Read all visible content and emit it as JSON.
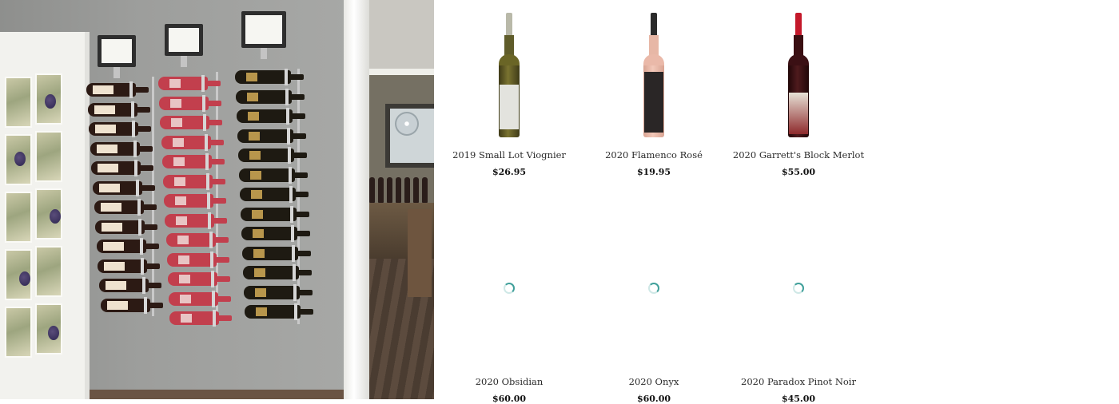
{
  "products": [
    {
      "name": "2019 Small Lot Viognier",
      "price": "$26.95",
      "image_state": "loaded",
      "bottle_color": "#5a5a22"
    },
    {
      "name": "2020 Flamenco Rosé",
      "price": "$19.95",
      "image_state": "loaded",
      "bottle_color": "#e9b9aa"
    },
    {
      "name": "2020 Garrett's Block Merlot",
      "price": "$55.00",
      "image_state": "loaded",
      "bottle_color": "#4a1216"
    },
    {
      "name": "2020 Obsidian",
      "price": "$60.00",
      "image_state": "loading"
    },
    {
      "name": "2020 Onyx",
      "price": "$60.00",
      "image_state": "loading"
    },
    {
      "name": "2020 Paradox Pinot Noir",
      "price": "$45.00",
      "image_state": "loading"
    }
  ],
  "colors": {
    "accent_spinner": "#3f9f9a",
    "wall": "#9d9e9c"
  },
  "icons": {
    "loading": "loading-spinner-icon"
  }
}
